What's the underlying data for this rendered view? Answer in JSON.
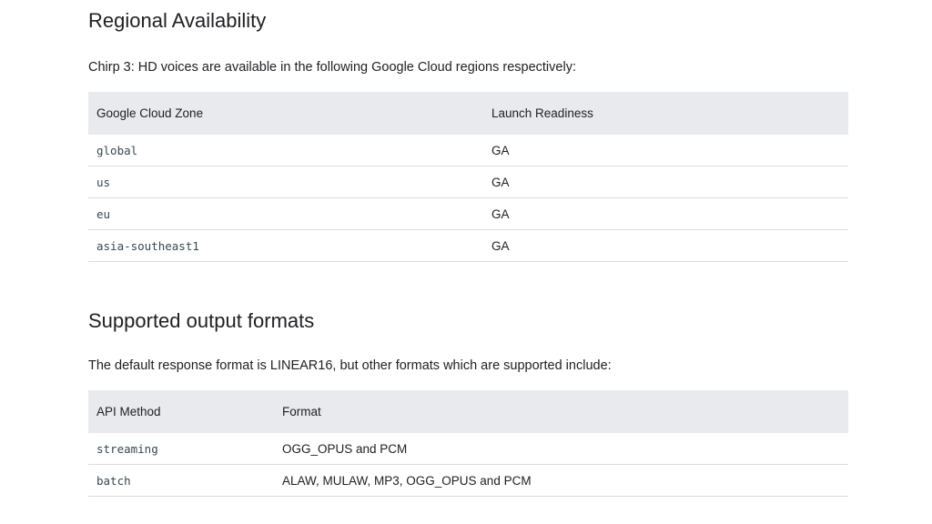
{
  "regional": {
    "heading": "Regional Availability",
    "intro": "Chirp 3: HD voices are available in the following Google Cloud regions respectively:",
    "columns": [
      "Google Cloud Zone",
      "Launch Readiness"
    ],
    "rows": [
      [
        "global",
        "GA"
      ],
      [
        "us",
        "GA"
      ],
      [
        "eu",
        "GA"
      ],
      [
        "asia-southeast1",
        "GA"
      ]
    ]
  },
  "formats": {
    "heading": "Supported output formats",
    "intro": "The default response format is LINEAR16, but other formats which are supported include:",
    "columns": [
      "API Method",
      "Format"
    ],
    "rows": [
      [
        "streaming",
        "OGG_OPUS and PCM"
      ],
      [
        "batch",
        "ALAW, MULAW, MP3, OGG_OPUS and PCM"
      ]
    ]
  }
}
